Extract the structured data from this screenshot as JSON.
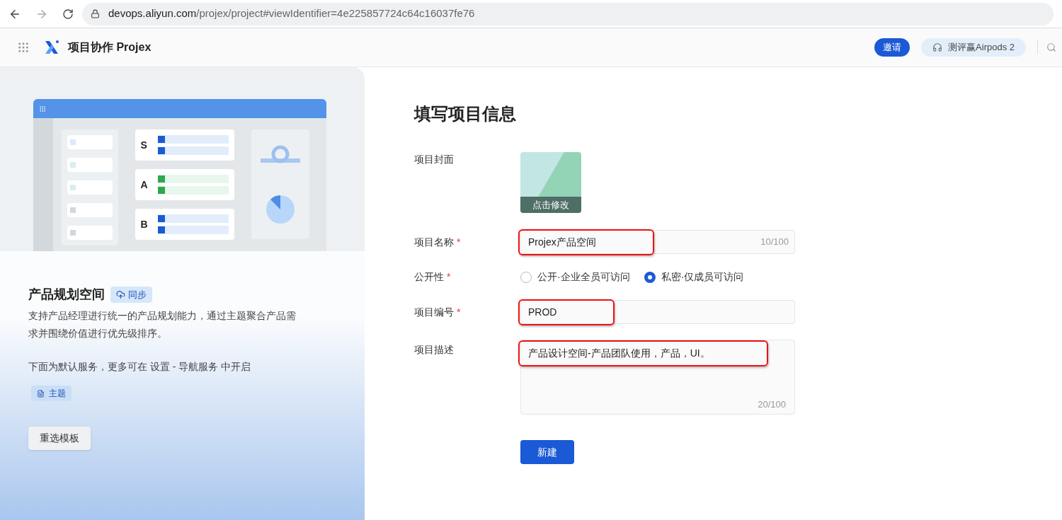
{
  "browser": {
    "url_host": "devops.aliyun.com",
    "url_path": "/projex/project#viewIdentifier=4e225857724c64c16037fe76"
  },
  "header": {
    "title": "项目协作 Projex",
    "invite_button": "邀请",
    "promo": "测评赢Airpods 2"
  },
  "template": {
    "illustration_labels": [
      "S",
      "A",
      "B"
    ],
    "name": "产品规划空间",
    "sync_badge": "同步",
    "description": "支持产品经理进行统一的产品规划能力，通过主题聚合产品需求并围绕价值进行优先级排序。",
    "services_note": "下面为默认服务，更多可在 设置 - 导航服务 中开启",
    "services": [
      "主题"
    ],
    "reselect_button": "重选模板"
  },
  "form": {
    "title": "填写项目信息",
    "cover": {
      "label": "项目封面",
      "action": "点击修改"
    },
    "fields": [
      {
        "kind": "text",
        "label": "项目名称",
        "required": true,
        "value": "Projex产品空间",
        "counter": "10/100",
        "highlighted": true
      },
      {
        "kind": "radio",
        "label": "公开性",
        "required": true,
        "options": [
          {
            "label": "公开·企业全员可访问",
            "selected": false
          },
          {
            "label": "私密·仅成员可访问",
            "selected": true
          }
        ]
      },
      {
        "kind": "text",
        "label": "项目编号",
        "required": true,
        "value": "PROD",
        "highlighted": true
      },
      {
        "kind": "textarea",
        "label": "项目描述",
        "required": false,
        "value": "产品设计空间-产品团队使用，产品，UI。",
        "counter": "20/100",
        "highlighted": true
      }
    ],
    "required_mark": "*",
    "submit": "新建"
  }
}
